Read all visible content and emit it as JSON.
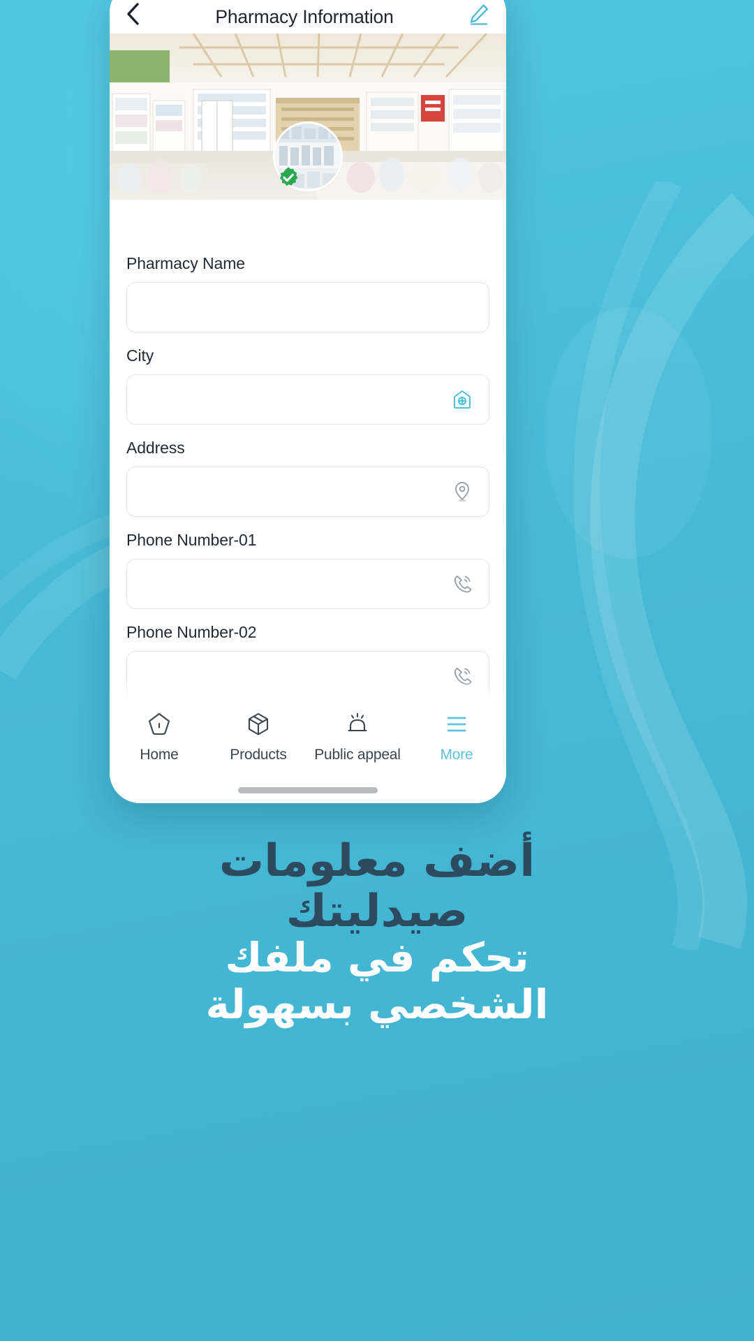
{
  "app": {
    "header": {
      "title": "Pharmacy Information",
      "back_icon": "chevron-left-icon",
      "edit_icon": "pencil-edit-icon"
    },
    "profile": {
      "cover_photo_alt": "pharmacy-interior-photo",
      "avatar_alt": "pharmacy-avatar-photo",
      "verified_badge_icon": "verified-check-badge"
    },
    "form": {
      "fields": [
        {
          "label": "Pharmacy Name",
          "value": "",
          "placeholder": "",
          "icon": ""
        },
        {
          "label": "City",
          "value": "",
          "placeholder": "",
          "icon": "city-building-icon"
        },
        {
          "label": "Address",
          "value": "",
          "placeholder": "",
          "icon": "location-pin-icon"
        },
        {
          "label": "Phone Number-01",
          "value": "",
          "placeholder": "",
          "icon": "phone-call-icon"
        },
        {
          "label": "Phone Number-02",
          "value": "",
          "placeholder": "",
          "icon": "phone-call-icon"
        }
      ]
    },
    "bottom_nav": {
      "items": [
        {
          "label": "Home",
          "icon": "home-pentagon-icon",
          "active": false
        },
        {
          "label": "Products",
          "icon": "package-box-icon",
          "active": false
        },
        {
          "label": "Public appeal",
          "icon": "siren-alarm-icon",
          "active": false
        },
        {
          "label": "More",
          "icon": "hamburger-menu-icon",
          "active": true
        }
      ],
      "active_color": "#5ec2e0",
      "inactive_color": "#3c444c"
    }
  },
  "promo": {
    "headline": "أضف معلومات صيدليتك",
    "subheadline": "تحكم في ملفك الشخصي بسهولة",
    "headline_color": "#2d4a5e",
    "subheadline_color": "#ffffff",
    "background_color": "#4EC3DD"
  }
}
